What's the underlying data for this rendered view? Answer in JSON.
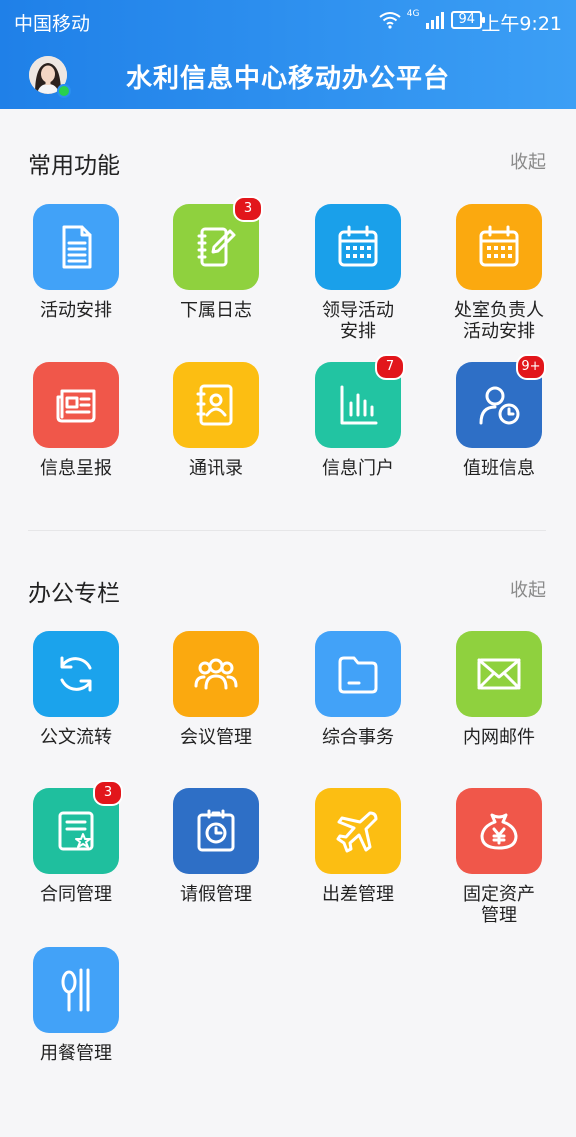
{
  "status_bar": {
    "carrier": "中国移动",
    "network": "4G",
    "battery": "94",
    "time": "上午9:21"
  },
  "header": {
    "title": "水利信息中心移动办公平台"
  },
  "sections": [
    {
      "title": "常用功能",
      "collapse_label": "收起",
      "items": [
        {
          "label": "活动安排",
          "badge": "",
          "color": "#41a2f8",
          "icon": "document-icon"
        },
        {
          "label": "下属日志",
          "badge": "3",
          "color": "#8fd13e",
          "icon": "notebook-pen-icon"
        },
        {
          "label": "领导活动\n安排",
          "badge": "",
          "color": "#1aa0ea",
          "icon": "calendar-icon"
        },
        {
          "label": "处室负责人\n活动安排",
          "badge": "",
          "color": "#fba90f",
          "icon": "calendar-icon"
        },
        {
          "label": "信息呈报",
          "badge": "",
          "color": "#f0574a",
          "icon": "newspaper-icon"
        },
        {
          "label": "通讯录",
          "badge": "",
          "color": "#fcbe12",
          "icon": "contact-book-icon"
        },
        {
          "label": "信息门户",
          "badge": "7",
          "color": "#22c4a2",
          "icon": "bar-chart-icon"
        },
        {
          "label": "值班信息",
          "badge": "9+",
          "color": "#2e6fc6",
          "icon": "user-clock-icon"
        }
      ]
    },
    {
      "title": "办公专栏",
      "collapse_label": "收起",
      "items": [
        {
          "label": "公文流转",
          "badge": "",
          "color": "#1ba3ec",
          "icon": "refresh-icon"
        },
        {
          "label": "会议管理",
          "badge": "",
          "color": "#fba90f",
          "icon": "people-group-icon"
        },
        {
          "label": "综合事务",
          "badge": "",
          "color": "#42a2f8",
          "icon": "folder-icon"
        },
        {
          "label": "内网邮件",
          "badge": "",
          "color": "#8fd13e",
          "icon": "mail-icon"
        },
        {
          "label": "合同管理",
          "badge": "3",
          "color": "#1fbf9e",
          "icon": "certificate-icon"
        },
        {
          "label": "请假管理",
          "badge": "",
          "color": "#2e6fc6",
          "icon": "clipboard-clock-icon"
        },
        {
          "label": "出差管理",
          "badge": "",
          "color": "#fcbe12",
          "icon": "airplane-icon"
        },
        {
          "label": "固定资产\n管理",
          "badge": "",
          "color": "#f0574a",
          "icon": "money-bag-icon"
        },
        {
          "label": "用餐管理",
          "badge": "",
          "color": "#42a2f8",
          "icon": "cutlery-icon"
        }
      ]
    }
  ]
}
